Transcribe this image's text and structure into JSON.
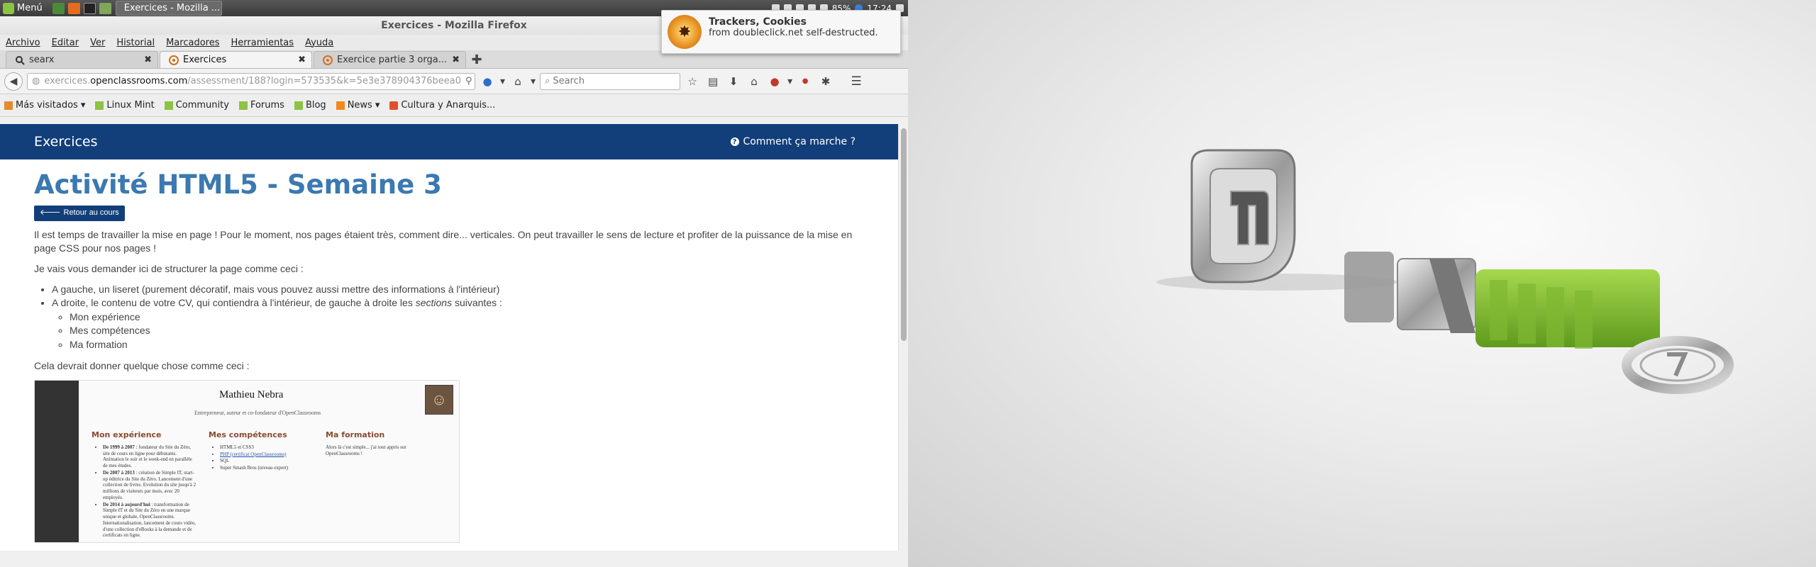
{
  "taskbar": {
    "menu_label": "Menú",
    "task_title": "Exercices - Mozilla ...",
    "battery": "85%",
    "clock": "17:24",
    "launchers": [
      "terminal-icon",
      "firefox-icon",
      "terminal2-icon",
      "files-icon"
    ]
  },
  "window": {
    "title": "Exercices - Mozilla Firefox",
    "menu": [
      "Archivo",
      "Editar",
      "Ver",
      "Historial",
      "Marcadores",
      "Herramientas",
      "Ayuda"
    ],
    "tabs": [
      {
        "label": "searx",
        "active": false
      },
      {
        "label": "Exercices",
        "active": true
      },
      {
        "label": "Exercice partie 3 orga...",
        "active": false
      }
    ],
    "url": {
      "prefix": "exercices.",
      "domain": "openclassrooms.com",
      "rest": "/assessment/188?login=573535&k=5e3e378904376beea0"
    },
    "search_placeholder": "Search",
    "bookmarks": [
      {
        "label": "Más visitados",
        "dropdown": true
      },
      {
        "label": "Linux Mint",
        "dropdown": false
      },
      {
        "label": "Community",
        "dropdown": false
      },
      {
        "label": "Forums",
        "dropdown": false
      },
      {
        "label": "Blog",
        "dropdown": false
      },
      {
        "label": "News",
        "dropdown": true
      },
      {
        "label": "Cultura y Anarquis...",
        "dropdown": false
      }
    ]
  },
  "notification": {
    "title": "Trackers, Cookies",
    "body": "from doubleclick.net self-destructed."
  },
  "page": {
    "header_title": "Exercices",
    "help_link": "Comment ça marche ?",
    "activity_title": "Activité HTML5 - Semaine 3",
    "back_button": "Retour au cours",
    "para1": "Il est temps de travailler la mise en page ! Pour le moment, nos pages étaient très, comment dire... verticales. On peut travailler le sens de lecture et profiter de la puissance de la mise en page CSS pour nos pages !",
    "para2": "Je vais vous demander ici de structurer la page comme ceci :",
    "bullet1": "A gauche, un liseret (purement décoratif, mais vous pouvez aussi mettre des informations à l'intérieur)",
    "bullet2_start": "A droite, le contenu de votre CV, qui contiendra à l'intérieur, de gauche à droite les ",
    "bullet2_em": "sections",
    "bullet2_end": " suivantes :",
    "sub_items": [
      "Mon expérience",
      "Mes compétences",
      "Ma formation"
    ],
    "para3": "Cela devrait donner quelque chose comme ceci :",
    "cv": {
      "name": "Mathieu Nebra",
      "subtitle": "Entrepreneur, auteur et co-fondateur d'OpenClassrooms",
      "col1_title": "Mon expérience",
      "col1_items": [
        {
          "bold": "De 1999 à 2007",
          "text": " : fondateur du Site du Zéro, site de cours en ligne pour débutants. Animation le soir et le week-end en parallèle de mes études."
        },
        {
          "bold": "De 2007 à 2013",
          "text": " : création de Simple IT, start-up éditrice du Site du Zéro. Lancement d'une collection de livres. Evolution du site jusqu'à 2 millions de visiteurs par mois, avec 20 employés."
        },
        {
          "bold": "De 2014 à aujourd'hui",
          "text": " : transformation de Simple IT et du Site du Zéro en une marque unique et globale, OpenClassrooms. Internationalisation, lancement de cours vidéo, d'une collection d'eBooks à la demande et de certificats en ligne."
        }
      ],
      "col2_title": "Mes compétences",
      "col2_items": [
        "HTML5 et CSS3",
        "PHP (certificat OpenClassrooms)",
        "SQL",
        "Super Smash Bros (niveau expert)"
      ],
      "col3_title": "Ma formation",
      "col3_text": "Alors là c'est simple... j'ai tout appris sur OpenClassrooms !"
    }
  },
  "colors": {
    "oc_blue": "#123f7a",
    "title_blue": "#3b79b0",
    "mint_green": "#8cc342"
  }
}
